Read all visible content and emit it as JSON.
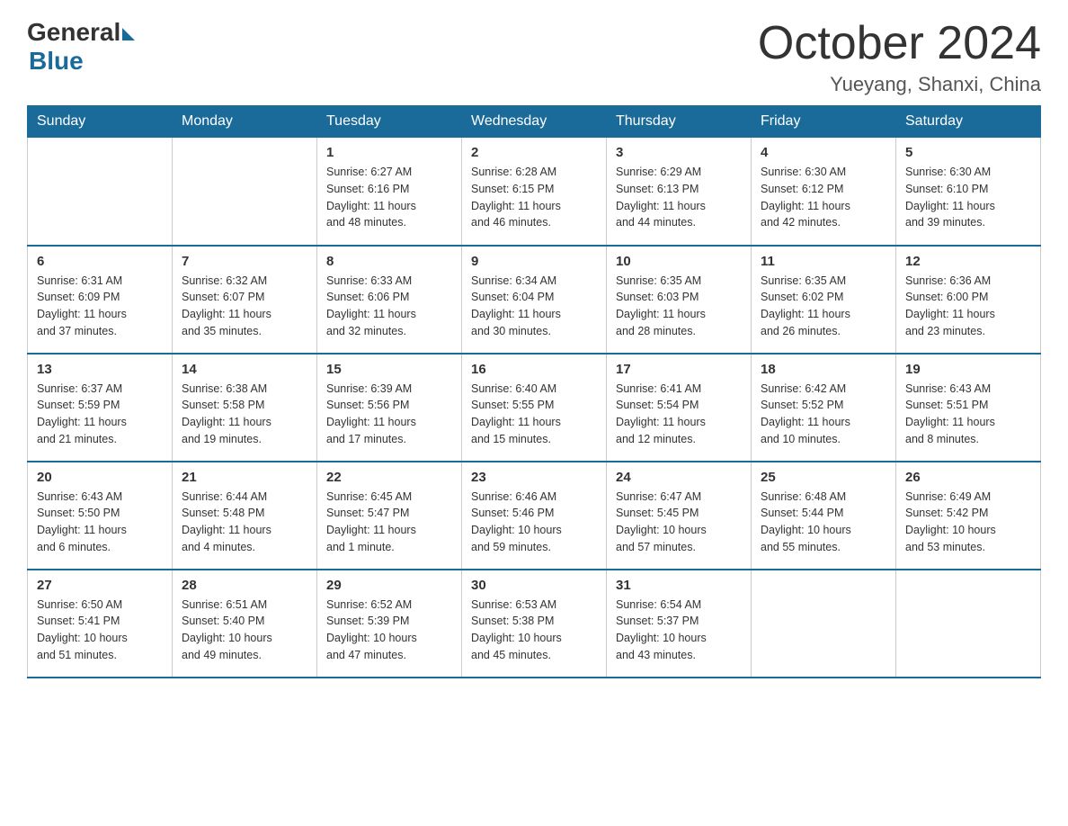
{
  "logo": {
    "general": "General",
    "blue": "Blue"
  },
  "title": "October 2024",
  "subtitle": "Yueyang, Shanxi, China",
  "days_of_week": [
    "Sunday",
    "Monday",
    "Tuesday",
    "Wednesday",
    "Thursday",
    "Friday",
    "Saturday"
  ],
  "weeks": [
    [
      {
        "day": "",
        "info": ""
      },
      {
        "day": "",
        "info": ""
      },
      {
        "day": "1",
        "info": "Sunrise: 6:27 AM\nSunset: 6:16 PM\nDaylight: 11 hours\nand 48 minutes."
      },
      {
        "day": "2",
        "info": "Sunrise: 6:28 AM\nSunset: 6:15 PM\nDaylight: 11 hours\nand 46 minutes."
      },
      {
        "day": "3",
        "info": "Sunrise: 6:29 AM\nSunset: 6:13 PM\nDaylight: 11 hours\nand 44 minutes."
      },
      {
        "day": "4",
        "info": "Sunrise: 6:30 AM\nSunset: 6:12 PM\nDaylight: 11 hours\nand 42 minutes."
      },
      {
        "day": "5",
        "info": "Sunrise: 6:30 AM\nSunset: 6:10 PM\nDaylight: 11 hours\nand 39 minutes."
      }
    ],
    [
      {
        "day": "6",
        "info": "Sunrise: 6:31 AM\nSunset: 6:09 PM\nDaylight: 11 hours\nand 37 minutes."
      },
      {
        "day": "7",
        "info": "Sunrise: 6:32 AM\nSunset: 6:07 PM\nDaylight: 11 hours\nand 35 minutes."
      },
      {
        "day": "8",
        "info": "Sunrise: 6:33 AM\nSunset: 6:06 PM\nDaylight: 11 hours\nand 32 minutes."
      },
      {
        "day": "9",
        "info": "Sunrise: 6:34 AM\nSunset: 6:04 PM\nDaylight: 11 hours\nand 30 minutes."
      },
      {
        "day": "10",
        "info": "Sunrise: 6:35 AM\nSunset: 6:03 PM\nDaylight: 11 hours\nand 28 minutes."
      },
      {
        "day": "11",
        "info": "Sunrise: 6:35 AM\nSunset: 6:02 PM\nDaylight: 11 hours\nand 26 minutes."
      },
      {
        "day": "12",
        "info": "Sunrise: 6:36 AM\nSunset: 6:00 PM\nDaylight: 11 hours\nand 23 minutes."
      }
    ],
    [
      {
        "day": "13",
        "info": "Sunrise: 6:37 AM\nSunset: 5:59 PM\nDaylight: 11 hours\nand 21 minutes."
      },
      {
        "day": "14",
        "info": "Sunrise: 6:38 AM\nSunset: 5:58 PM\nDaylight: 11 hours\nand 19 minutes."
      },
      {
        "day": "15",
        "info": "Sunrise: 6:39 AM\nSunset: 5:56 PM\nDaylight: 11 hours\nand 17 minutes."
      },
      {
        "day": "16",
        "info": "Sunrise: 6:40 AM\nSunset: 5:55 PM\nDaylight: 11 hours\nand 15 minutes."
      },
      {
        "day": "17",
        "info": "Sunrise: 6:41 AM\nSunset: 5:54 PM\nDaylight: 11 hours\nand 12 minutes."
      },
      {
        "day": "18",
        "info": "Sunrise: 6:42 AM\nSunset: 5:52 PM\nDaylight: 11 hours\nand 10 minutes."
      },
      {
        "day": "19",
        "info": "Sunrise: 6:43 AM\nSunset: 5:51 PM\nDaylight: 11 hours\nand 8 minutes."
      }
    ],
    [
      {
        "day": "20",
        "info": "Sunrise: 6:43 AM\nSunset: 5:50 PM\nDaylight: 11 hours\nand 6 minutes."
      },
      {
        "day": "21",
        "info": "Sunrise: 6:44 AM\nSunset: 5:48 PM\nDaylight: 11 hours\nand 4 minutes."
      },
      {
        "day": "22",
        "info": "Sunrise: 6:45 AM\nSunset: 5:47 PM\nDaylight: 11 hours\nand 1 minute."
      },
      {
        "day": "23",
        "info": "Sunrise: 6:46 AM\nSunset: 5:46 PM\nDaylight: 10 hours\nand 59 minutes."
      },
      {
        "day": "24",
        "info": "Sunrise: 6:47 AM\nSunset: 5:45 PM\nDaylight: 10 hours\nand 57 minutes."
      },
      {
        "day": "25",
        "info": "Sunrise: 6:48 AM\nSunset: 5:44 PM\nDaylight: 10 hours\nand 55 minutes."
      },
      {
        "day": "26",
        "info": "Sunrise: 6:49 AM\nSunset: 5:42 PM\nDaylight: 10 hours\nand 53 minutes."
      }
    ],
    [
      {
        "day": "27",
        "info": "Sunrise: 6:50 AM\nSunset: 5:41 PM\nDaylight: 10 hours\nand 51 minutes."
      },
      {
        "day": "28",
        "info": "Sunrise: 6:51 AM\nSunset: 5:40 PM\nDaylight: 10 hours\nand 49 minutes."
      },
      {
        "day": "29",
        "info": "Sunrise: 6:52 AM\nSunset: 5:39 PM\nDaylight: 10 hours\nand 47 minutes."
      },
      {
        "day": "30",
        "info": "Sunrise: 6:53 AM\nSunset: 5:38 PM\nDaylight: 10 hours\nand 45 minutes."
      },
      {
        "day": "31",
        "info": "Sunrise: 6:54 AM\nSunset: 5:37 PM\nDaylight: 10 hours\nand 43 minutes."
      },
      {
        "day": "",
        "info": ""
      },
      {
        "day": "",
        "info": ""
      }
    ]
  ]
}
